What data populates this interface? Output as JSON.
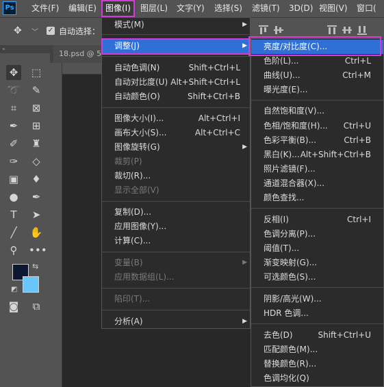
{
  "app": {
    "logo_text": "Ps"
  },
  "menubar": {
    "items": [
      "文件(F)",
      "编辑(E)",
      "图像(I)",
      "图层(L)",
      "文字(Y)",
      "选择(S)",
      "滤镜(T)",
      "3D(D)",
      "视图(V)",
      "窗口("
    ]
  },
  "options": {
    "autoselect_label": "自动选择："
  },
  "document": {
    "tab_label": "18.psd @ 5"
  },
  "colors": {
    "foreground": "#0c1832",
    "background": "#6ac6f8",
    "highlight": "#2f6fd6",
    "callout": "#d33bd6"
  },
  "image_menu": {
    "mode": {
      "label": "模式(M)"
    },
    "adjust": {
      "label": "调整(J)"
    },
    "auto_tone": {
      "label": "自动色调(N)",
      "shortcut": "Shift+Ctrl+L"
    },
    "auto_contrast": {
      "label": "自动对比度(U)",
      "shortcut": "Alt+Shift+Ctrl+L"
    },
    "auto_color": {
      "label": "自动颜色(O)",
      "shortcut": "Shift+Ctrl+B"
    },
    "image_size": {
      "label": "图像大小(I)...",
      "shortcut": "Alt+Ctrl+I"
    },
    "canvas_size": {
      "label": "画布大小(S)...",
      "shortcut": "Alt+Ctrl+C"
    },
    "image_rotation": {
      "label": "图像旋转(G)"
    },
    "crop": {
      "label": "裁剪(P)"
    },
    "trim": {
      "label": "裁切(R)..."
    },
    "reveal_all": {
      "label": "显示全部(V)"
    },
    "duplicate": {
      "label": "复制(D)..."
    },
    "apply_image": {
      "label": "应用图像(Y)..."
    },
    "calculations": {
      "label": "计算(C)..."
    },
    "variables": {
      "label": "变量(B)"
    },
    "apply_data_set": {
      "label": "应用数据组(L)..."
    },
    "trap": {
      "label": "陷印(T)..."
    },
    "analysis": {
      "label": "分析(A)"
    }
  },
  "adjust_menu": {
    "brightness_contrast": {
      "label": "亮度/对比度(C)..."
    },
    "levels": {
      "label": "色阶(L)...",
      "shortcut": "Ctrl+L"
    },
    "curves": {
      "label": "曲线(U)...",
      "shortcut": "Ctrl+M"
    },
    "exposure": {
      "label": "曝光度(E)..."
    },
    "vibrance": {
      "label": "自然饱和度(V)..."
    },
    "hue_saturation": {
      "label": "色相/饱和度(H)...",
      "shortcut": "Ctrl+U"
    },
    "color_balance": {
      "label": "色彩平衡(B)...",
      "shortcut": "Ctrl+B"
    },
    "black_white": {
      "label": "黑白(K)...",
      "shortcut": "Alt+Shift+Ctrl+B"
    },
    "photo_filter": {
      "label": "照片滤镜(F)..."
    },
    "channel_mixer": {
      "label": "通道混合器(X)..."
    },
    "color_lookup": {
      "label": "颜色查找..."
    },
    "invert": {
      "label": "反相(I)",
      "shortcut": "Ctrl+I"
    },
    "posterize": {
      "label": "色调分离(P)..."
    },
    "threshold": {
      "label": "阈值(T)..."
    },
    "gradient_map": {
      "label": "渐变映射(G)..."
    },
    "selective_color": {
      "label": "可选颜色(S)..."
    },
    "shadows_highlights": {
      "label": "阴影/高光(W)..."
    },
    "hdr_toning": {
      "label": "HDR 色调..."
    },
    "desaturate": {
      "label": "去色(D)",
      "shortcut": "Shift+Ctrl+U"
    },
    "match_color": {
      "label": "匹配颜色(M)..."
    },
    "replace_color": {
      "label": "替换颜色(R)..."
    },
    "equalize": {
      "label": "色调均化(Q)"
    }
  }
}
